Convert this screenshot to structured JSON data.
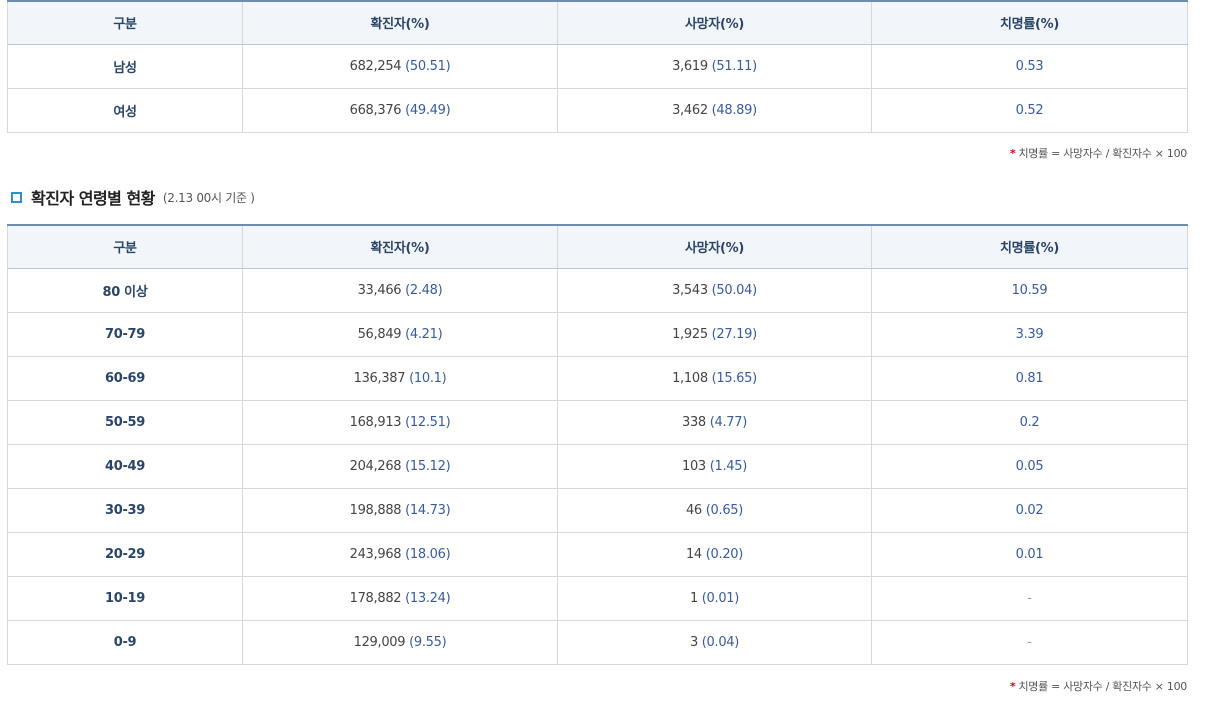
{
  "header": {
    "col1": "구분",
    "col2": "확진자(%)",
    "col3": "사망자(%)",
    "col4": "치명률(%)"
  },
  "gender_table": {
    "rows": [
      {
        "label": "남성",
        "confirmed": "682,254",
        "confirmed_pct": "(50.51)",
        "deaths": "3,619",
        "deaths_pct": "(51.11)",
        "fatality": "0.53"
      },
      {
        "label": "여성",
        "confirmed": "668,376",
        "confirmed_pct": "(49.49)",
        "deaths": "3,462",
        "deaths_pct": "(48.89)",
        "fatality": "0.52"
      }
    ]
  },
  "note": {
    "star": "*",
    "text": "치명률 = 사망자수 / 확진자수 × 100"
  },
  "age_section": {
    "title": "확진자 연령별 현황",
    "subtitle": "(2.13 00시 기준 )"
  },
  "age_table": {
    "rows": [
      {
        "label": "80 이상",
        "confirmed": "33,466",
        "confirmed_pct": "(2.48)",
        "deaths": "3,543",
        "deaths_pct": "(50.04)",
        "fatality": "10.59"
      },
      {
        "label": "70-79",
        "confirmed": "56,849",
        "confirmed_pct": "(4.21)",
        "deaths": "1,925",
        "deaths_pct": "(27.19)",
        "fatality": "3.39"
      },
      {
        "label": "60-69",
        "confirmed": "136,387",
        "confirmed_pct": "(10.1)",
        "deaths": "1,108",
        "deaths_pct": "(15.65)",
        "fatality": "0.81"
      },
      {
        "label": "50-59",
        "confirmed": "168,913",
        "confirmed_pct": "(12.51)",
        "deaths": "338",
        "deaths_pct": "(4.77)",
        "fatality": "0.2"
      },
      {
        "label": "40-49",
        "confirmed": "204,268",
        "confirmed_pct": "(15.12)",
        "deaths": "103",
        "deaths_pct": "(1.45)",
        "fatality": "0.05"
      },
      {
        "label": "30-39",
        "confirmed": "198,888",
        "confirmed_pct": "(14.73)",
        "deaths": "46",
        "deaths_pct": "(0.65)",
        "fatality": "0.02"
      },
      {
        "label": "20-29",
        "confirmed": "243,968",
        "confirmed_pct": "(18.06)",
        "deaths": "14",
        "deaths_pct": "(0.20)",
        "fatality": "0.01"
      },
      {
        "label": "10-19",
        "confirmed": "178,882",
        "confirmed_pct": "(13.24)",
        "deaths": "1",
        "deaths_pct": "(0.01)",
        "fatality": "-"
      },
      {
        "label": "0-9",
        "confirmed": "129,009",
        "confirmed_pct": "(9.55)",
        "deaths": "3",
        "deaths_pct": "(0.04)",
        "fatality": "-"
      }
    ]
  }
}
